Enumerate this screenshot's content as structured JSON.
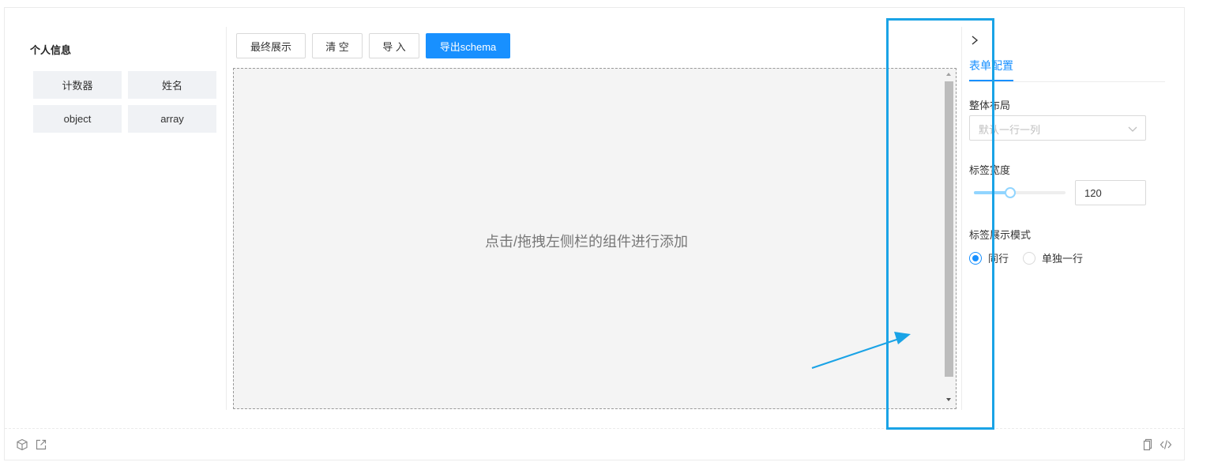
{
  "palette": {
    "group_title": "个人信息",
    "items": [
      "计数器",
      "姓名",
      "object",
      "array"
    ]
  },
  "toolbar": {
    "final_display": "最终展示",
    "clear": "清 空",
    "import": "导 入",
    "export_schema": "导出schema"
  },
  "canvas": {
    "hint": "点击/拖拽左侧栏的组件进行添加"
  },
  "settings": {
    "tab_label": "表单配置",
    "layout_label": "整体布局",
    "layout_placeholder": "默认一行一列",
    "label_width_label": "标签宽度",
    "label_width_value": "120",
    "label_width_slider_fraction": 0.4,
    "label_mode_label": "标签展示模式",
    "label_mode_options": [
      "同行",
      "单独一行"
    ],
    "label_mode_selected": 0
  },
  "colors": {
    "accent": "#1890ff",
    "annotation": "#1aa3e6"
  },
  "icons": {
    "footer_left": [
      "cube-icon",
      "external-link-icon"
    ],
    "footer_right": [
      "copy-icon",
      "code-icon"
    ],
    "collapse": "chevron-right-icon"
  }
}
